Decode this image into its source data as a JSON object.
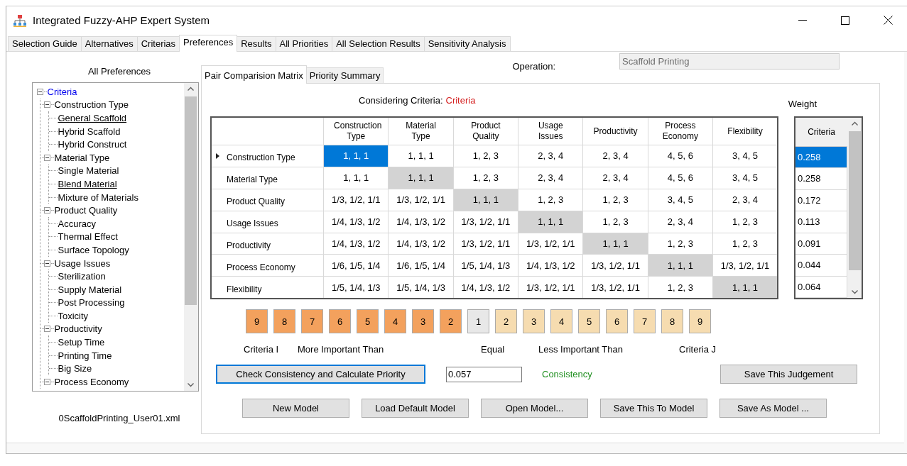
{
  "window": {
    "title": "Integrated Fuzzy-AHP Expert System"
  },
  "tabs": [
    {
      "label": "Selection Guide",
      "selected": false
    },
    {
      "label": "Alternatives",
      "selected": false
    },
    {
      "label": "Criterias",
      "selected": false
    },
    {
      "label": "Preferences",
      "selected": true
    },
    {
      "label": "Results",
      "selected": false
    },
    {
      "label": "All Priorities",
      "selected": false
    },
    {
      "label": "All Selection Results",
      "selected": false
    },
    {
      "label": "Sensitivity Analysis",
      "selected": false
    }
  ],
  "preferences_panel": {
    "title": "All Preferences",
    "tree": [
      {
        "label": "Criteria",
        "expanded": true,
        "selected": true,
        "underlined": false,
        "children": [
          {
            "label": "Construction Type",
            "expanded": true,
            "selected": false,
            "underlined": false,
            "children": [
              {
                "label": "General Scaffold",
                "selected": false,
                "underlined": true
              },
              {
                "label": "Hybrid Scaffold",
                "selected": false,
                "underlined": false
              },
              {
                "label": "Hybrid Construct",
                "selected": false,
                "underlined": false
              }
            ]
          },
          {
            "label": "Material Type",
            "expanded": true,
            "selected": false,
            "underlined": false,
            "children": [
              {
                "label": "Single Material",
                "selected": false,
                "underlined": false
              },
              {
                "label": "Blend Material",
                "selected": false,
                "underlined": true
              },
              {
                "label": "Mixture of Materials",
                "selected": false,
                "underlined": false
              }
            ]
          },
          {
            "label": "Product Quality",
            "expanded": true,
            "selected": false,
            "underlined": false,
            "children": [
              {
                "label": "Accuracy",
                "selected": false,
                "underlined": false
              },
              {
                "label": "Thermal Effect",
                "selected": false,
                "underlined": false
              },
              {
                "label": "Surface Topology",
                "selected": false,
                "underlined": false
              }
            ]
          },
          {
            "label": "Usage Issues",
            "expanded": true,
            "selected": false,
            "underlined": false,
            "children": [
              {
                "label": "Sterilization",
                "selected": false,
                "underlined": false
              },
              {
                "label": "Supply Material",
                "selected": false,
                "underlined": false
              },
              {
                "label": "Post Processing",
                "selected": false,
                "underlined": false
              },
              {
                "label": "Toxicity",
                "selected": false,
                "underlined": false
              }
            ]
          },
          {
            "label": "Productivity",
            "expanded": true,
            "selected": false,
            "underlined": false,
            "children": [
              {
                "label": "Setup Time",
                "selected": false,
                "underlined": false
              },
              {
                "label": "Printing Time",
                "selected": false,
                "underlined": false
              },
              {
                "label": "Big Size",
                "selected": false,
                "underlined": false
              }
            ]
          },
          {
            "label": "Process Economy",
            "expanded": true,
            "selected": false,
            "underlined": false
          }
        ]
      }
    ],
    "filename": "0ScaffoldPrinting_User01.xml"
  },
  "inner_tabs": [
    {
      "label": "Pair Comparision Matrix",
      "selected": true
    },
    {
      "label": "Priority Summary",
      "selected": false
    }
  ],
  "operation": {
    "label": "Operation:",
    "value": "Scaffold Printing"
  },
  "considering": {
    "label": "Considering Criteria:",
    "value": "Criteria"
  },
  "matrix": {
    "columns": [
      "Construction Type",
      "Material Type",
      "Product Quality",
      "Usage Issues",
      "Productivity",
      "Process Economy",
      "Flexibility"
    ],
    "rows": [
      {
        "label": "Construction Type",
        "current": true,
        "cells": [
          {
            "v": "1, 1, 1",
            "selected": true,
            "disabled": false
          },
          {
            "v": "1, 1, 1",
            "selected": false,
            "disabled": false
          },
          {
            "v": "1, 2, 3",
            "selected": false,
            "disabled": false
          },
          {
            "v": "2, 3, 4",
            "selected": false,
            "disabled": false
          },
          {
            "v": "2, 3, 4",
            "selected": false,
            "disabled": false
          },
          {
            "v": "4, 5, 6",
            "selected": false,
            "disabled": false
          },
          {
            "v": "3, 4, 5",
            "selected": false,
            "disabled": false
          }
        ]
      },
      {
        "label": "Material Type",
        "current": false,
        "cells": [
          {
            "v": "1, 1, 1",
            "selected": false,
            "disabled": false
          },
          {
            "v": "1, 1, 1",
            "selected": false,
            "disabled": true
          },
          {
            "v": "1, 2, 3",
            "selected": false,
            "disabled": false
          },
          {
            "v": "2, 3, 4",
            "selected": false,
            "disabled": false
          },
          {
            "v": "2, 3, 4",
            "selected": false,
            "disabled": false
          },
          {
            "v": "4, 5, 6",
            "selected": false,
            "disabled": false
          },
          {
            "v": "3, 4, 5",
            "selected": false,
            "disabled": false
          }
        ]
      },
      {
        "label": "Product Quality",
        "current": false,
        "cells": [
          {
            "v": "1/3, 1/2, 1/1",
            "selected": false,
            "disabled": false
          },
          {
            "v": "1/3, 1/2, 1/1",
            "selected": false,
            "disabled": false
          },
          {
            "v": "1, 1, 1",
            "selected": false,
            "disabled": true
          },
          {
            "v": "1, 2, 3",
            "selected": false,
            "disabled": false
          },
          {
            "v": "1, 2, 3",
            "selected": false,
            "disabled": false
          },
          {
            "v": "3, 4, 5",
            "selected": false,
            "disabled": false
          },
          {
            "v": "2, 3, 4",
            "selected": false,
            "disabled": false
          }
        ]
      },
      {
        "label": "Usage Issues",
        "current": false,
        "cells": [
          {
            "v": "1/4, 1/3, 1/2",
            "selected": false,
            "disabled": false
          },
          {
            "v": "1/4, 1/3, 1/2",
            "selected": false,
            "disabled": false
          },
          {
            "v": "1/3, 1/2, 1/1",
            "selected": false,
            "disabled": false
          },
          {
            "v": "1, 1, 1",
            "selected": false,
            "disabled": true
          },
          {
            "v": "1, 2, 3",
            "selected": false,
            "disabled": false
          },
          {
            "v": "2, 3, 4",
            "selected": false,
            "disabled": false
          },
          {
            "v": "1, 2, 3",
            "selected": false,
            "disabled": false
          }
        ]
      },
      {
        "label": "Productivity",
        "current": false,
        "cells": [
          {
            "v": "1/4, 1/3, 1/2",
            "selected": false,
            "disabled": false
          },
          {
            "v": "1/4, 1/3, 1/2",
            "selected": false,
            "disabled": false
          },
          {
            "v": "1/3, 1/2, 1/1",
            "selected": false,
            "disabled": false
          },
          {
            "v": "1/3, 1/2, 1/1",
            "selected": false,
            "disabled": false
          },
          {
            "v": "1, 1, 1",
            "selected": false,
            "disabled": true
          },
          {
            "v": "1, 2, 3",
            "selected": false,
            "disabled": false
          },
          {
            "v": "1, 2, 3",
            "selected": false,
            "disabled": false
          }
        ]
      },
      {
        "label": "Process Economy",
        "current": false,
        "cells": [
          {
            "v": "1/6, 1/5, 1/4",
            "selected": false,
            "disabled": false
          },
          {
            "v": "1/6, 1/5, 1/4",
            "selected": false,
            "disabled": false
          },
          {
            "v": "1/5, 1/4, 1/3",
            "selected": false,
            "disabled": false
          },
          {
            "v": "1/4, 1/3, 1/2",
            "selected": false,
            "disabled": false
          },
          {
            "v": "1/3, 1/2, 1/1",
            "selected": false,
            "disabled": false
          },
          {
            "v": "1, 1, 1",
            "selected": false,
            "disabled": true
          },
          {
            "v": "1/3, 1/2, 1/1",
            "selected": false,
            "disabled": false
          }
        ]
      },
      {
        "label": "Flexibility",
        "current": false,
        "cells": [
          {
            "v": "1/5, 1/4, 1/3",
            "selected": false,
            "disabled": false
          },
          {
            "v": "1/5, 1/4, 1/3",
            "selected": false,
            "disabled": false
          },
          {
            "v": "1/4, 1/3, 1/2",
            "selected": false,
            "disabled": false
          },
          {
            "v": "1/3, 1/2, 1/1",
            "selected": false,
            "disabled": false
          },
          {
            "v": "1/3, 1/2, 1/1",
            "selected": false,
            "disabled": false
          },
          {
            "v": "1, 2, 3",
            "selected": false,
            "disabled": false
          },
          {
            "v": "1, 1, 1",
            "selected": false,
            "disabled": true
          }
        ]
      }
    ]
  },
  "weight": {
    "title": "Weight",
    "column": "Criteria",
    "values": [
      {
        "v": "0.258",
        "selected": true
      },
      {
        "v": "0.258",
        "selected": false
      },
      {
        "v": "0.172",
        "selected": false
      },
      {
        "v": "0.113",
        "selected": false
      },
      {
        "v": "0.091",
        "selected": false
      },
      {
        "v": "0.044",
        "selected": false
      },
      {
        "v": "0.064",
        "selected": false
      }
    ]
  },
  "scale": [
    {
      "label": "9",
      "kind": "more"
    },
    {
      "label": "8",
      "kind": "more"
    },
    {
      "label": "7",
      "kind": "more"
    },
    {
      "label": "6",
      "kind": "more"
    },
    {
      "label": "5",
      "kind": "more"
    },
    {
      "label": "4",
      "kind": "more"
    },
    {
      "label": "3",
      "kind": "more"
    },
    {
      "label": "2",
      "kind": "more"
    },
    {
      "label": "1",
      "kind": "equal"
    },
    {
      "label": "2",
      "kind": "less"
    },
    {
      "label": "3",
      "kind": "less"
    },
    {
      "label": "4",
      "kind": "less"
    },
    {
      "label": "5",
      "kind": "less"
    },
    {
      "label": "6",
      "kind": "less"
    },
    {
      "label": "7",
      "kind": "less"
    },
    {
      "label": "8",
      "kind": "less"
    },
    {
      "label": "9",
      "kind": "less"
    }
  ],
  "scale_labels": [
    "Criteria I",
    "More Important Than",
    "Equal",
    "Less Important Than",
    "Criteria J"
  ],
  "check_button": "Check Consistency and Calculate Priority",
  "consistency_value": "0.057",
  "consistency_status": "Consistency",
  "save_judgement_button": "Save This Judgement",
  "model_buttons": [
    "New Model",
    "Load Default Model",
    "Open Model...",
    "Save This To Model",
    "Save As Model ..."
  ]
}
